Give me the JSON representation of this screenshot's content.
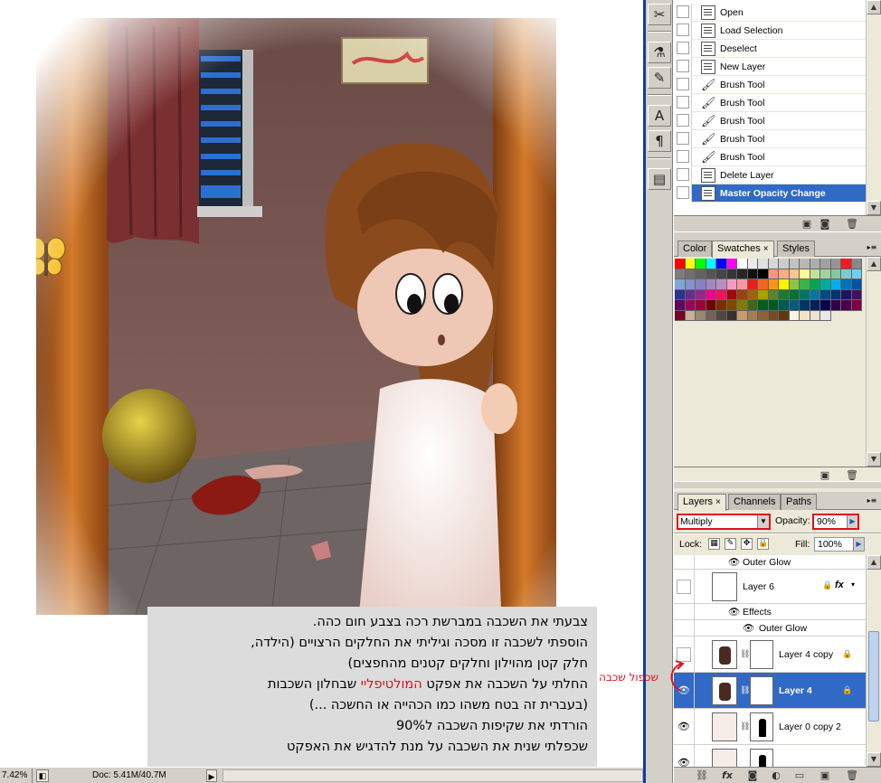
{
  "status": {
    "zoom": "7.42%",
    "doc": "Doc: 5.41M/40.7M"
  },
  "history": {
    "items": [
      {
        "label": "Open",
        "icon": "document-icon"
      },
      {
        "label": "Load Selection",
        "icon": "document-icon"
      },
      {
        "label": "Deselect",
        "icon": "document-icon"
      },
      {
        "label": "New Layer",
        "icon": "document-icon"
      },
      {
        "label": "Brush Tool",
        "icon": "brush-icon"
      },
      {
        "label": "Brush Tool",
        "icon": "brush-icon"
      },
      {
        "label": "Brush Tool",
        "icon": "brush-icon"
      },
      {
        "label": "Brush Tool",
        "icon": "brush-icon"
      },
      {
        "label": "Brush Tool",
        "icon": "brush-icon"
      },
      {
        "label": "Delete Layer",
        "icon": "document-icon"
      },
      {
        "label": "Master Opacity Change",
        "icon": "document-icon",
        "selected": true
      }
    ]
  },
  "swatches_panel": {
    "tabs": [
      {
        "label": "Color"
      },
      {
        "label": "Swatches",
        "active": true
      },
      {
        "label": "Styles"
      }
    ],
    "close_glyph": "×",
    "colors": [
      "#ff0000",
      "#ffff00",
      "#00ff00",
      "#00ffff",
      "#0000ff",
      "#ff00ff",
      "#ffffff",
      "#ebebeb",
      "#e1e1e1",
      "#d7d7d7",
      "#cccccc",
      "#c2c2c2",
      "#b7b7b7",
      "#acacac",
      "#a0a0a0",
      "#959595",
      "#ee1c24",
      "#898989",
      "#7d7d7d",
      "#707070",
      "#626262",
      "#555555",
      "#464646",
      "#363636",
      "#262626",
      "#111111",
      "#000000",
      "#f7977a",
      "#f9ad81",
      "#fdc68a",
      "#fff79a",
      "#c4df9b",
      "#a2d39c",
      "#82ca9d",
      "#7bcdc8",
      "#6ecff6",
      "#7ea7d8",
      "#8493ca",
      "#8882be",
      "#a187be",
      "#bc8dbf",
      "#f49ac2",
      "#f6989d",
      "#ed1c24",
      "#f26522",
      "#f7941d",
      "#fff200",
      "#8dc63f",
      "#39b54a",
      "#00a651",
      "#00a99d",
      "#00aeef",
      "#0072bc",
      "#0054a6",
      "#2e3192",
      "#662d91",
      "#92278f",
      "#ec008c",
      "#ed145b",
      "#9e0b0f",
      "#a0410d",
      "#a36209",
      "#aba000",
      "#598527",
      "#1a7b30",
      "#007236",
      "#00746b",
      "#0076a3",
      "#004b80",
      "#003471",
      "#1b1464",
      "#440e62",
      "#630460",
      "#9e005d",
      "#9e0039",
      "#790000",
      "#7b2e00",
      "#7d4900",
      "#827b00",
      "#406618",
      "#005e20",
      "#005826",
      "#005952",
      "#005b7f",
      "#003663",
      "#002157",
      "#0d004c",
      "#32004b",
      "#4b0049",
      "#7b0046",
      "#7a0026",
      "#c7b299",
      "#998675",
      "#736357",
      "#534741",
      "#37302d",
      "#c69c6d",
      "#a67c52",
      "#8c6239",
      "#754c24",
      "#603913",
      "#fff6e0",
      "#f5e3c9",
      "#ede3cf",
      "#e8e8e8"
    ]
  },
  "layers_panel": {
    "tabs": [
      {
        "label": "Layers",
        "active": true
      },
      {
        "label": "Channels"
      },
      {
        "label": "Paths"
      }
    ],
    "close_glyph": "×",
    "blend_mode": "Multiply",
    "opacity_label": "Opacity:",
    "opacity_value": "90%",
    "lock_label": "Lock:",
    "fill_label": "Fill:",
    "fill_value": "100%",
    "rows": [
      {
        "kind": "effect",
        "label": "Outer Glow"
      },
      {
        "kind": "layer",
        "label": "Layer 6"
      },
      {
        "kind": "effects",
        "label": "Effects"
      },
      {
        "kind": "effect",
        "label": "Outer Glow"
      },
      {
        "kind": "layer",
        "label": "Layer 4 copy"
      },
      {
        "kind": "layer",
        "label": "Layer 4",
        "selected": true
      },
      {
        "kind": "layer",
        "label": "Layer 0 copy 2"
      }
    ]
  },
  "annotation": {
    "duplicate_layer": "שכפול שכבה"
  },
  "caption": {
    "lines": [
      "צבעתי את השכבה במברשת רכה בצבע חום כהה.",
      "הוספתי לשכבה זו מסכה וגיליתי את החלקים הרצויים (הילדה,",
      "חלק קטן מהוילון וחלקים קטנים מהחפצים)",
      "שבחלון השכבות",
      "המולטיפליי",
      "החלתי על השכבה את אפקט",
      "(בעברית זה בטח משהו כמו הכהייה או החשכה ...)",
      "הורדתי את שקיפות השכבה ל90%",
      "שכפלתי שנית את השכבה על מנת להדגיש את האפקט"
    ]
  },
  "colors": {
    "accent_red": "#e0101e",
    "selection_blue": "#3169c6",
    "panel_gray": "#d4d0c8"
  }
}
